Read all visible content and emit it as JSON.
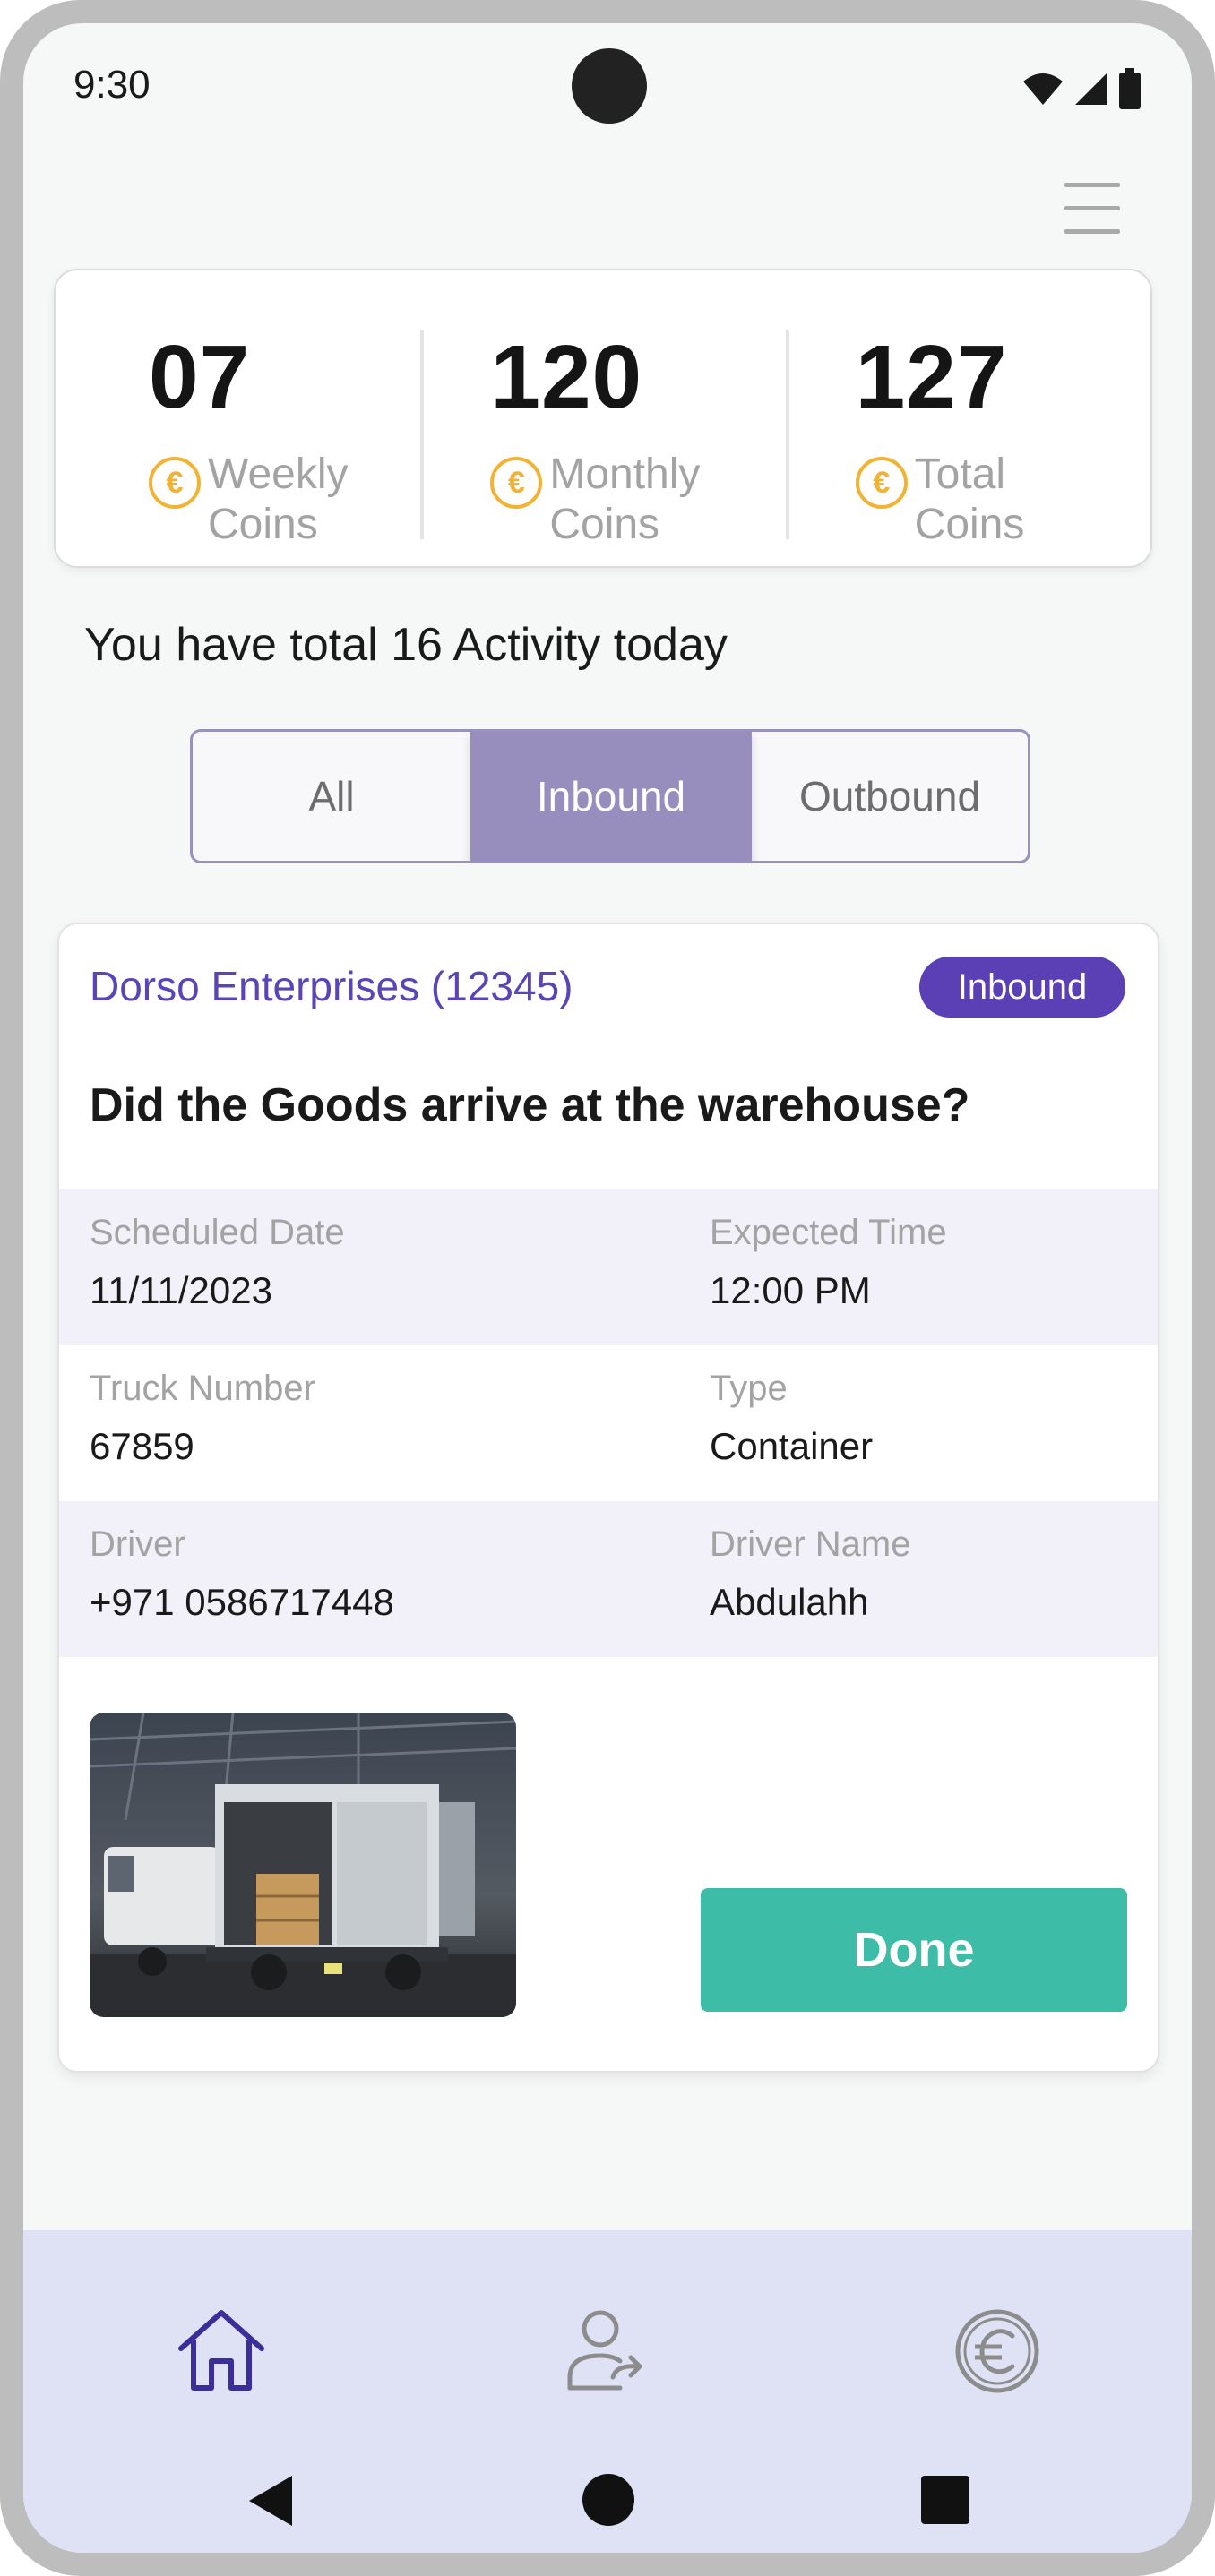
{
  "status_bar": {
    "time": "9:30"
  },
  "coins": [
    {
      "value": "07",
      "label": "Weekly Coins"
    },
    {
      "value": "120",
      "label": "Monthly Coins"
    },
    {
      "value": "127",
      "label": "Total Coins"
    }
  ],
  "activity_text": "You have total 16 Activity today",
  "tabs": [
    {
      "label": "All",
      "active": false
    },
    {
      "label": "Inbound",
      "active": true
    },
    {
      "label": "Outbound",
      "active": false
    }
  ],
  "card": {
    "company": "Dorso Enterprises (12345)",
    "badge": "Inbound",
    "question": "Did the Goods arrive at the warehouse?",
    "rows": [
      {
        "left": {
          "label": "Scheduled Date",
          "value": "11/11/2023"
        },
        "right": {
          "label": "Expected Time",
          "value": "12:00 PM"
        }
      },
      {
        "left": {
          "label": "Truck Number",
          "value": "67859"
        },
        "right": {
          "label": "Type",
          "value": "Container"
        }
      },
      {
        "left": {
          "label": "Driver",
          "value": "+971 0586717448"
        },
        "right": {
          "label": "Driver Name",
          "value": "Abdulahh"
        }
      }
    ],
    "done_label": "Done"
  },
  "icons": {
    "nav": [
      "home-icon",
      "user-transfer-icon",
      "euro-coin-icon"
    ],
    "system": [
      "back-icon",
      "home-circle-icon",
      "recents-icon"
    ],
    "coin_symbol": "€"
  },
  "colors": {
    "accent_purple": "#5a3fb5",
    "tab_active": "#978ebd",
    "done_green": "#3dbda8",
    "coin_orange": "#f2b233",
    "nav_background": "#dfe2f4"
  }
}
